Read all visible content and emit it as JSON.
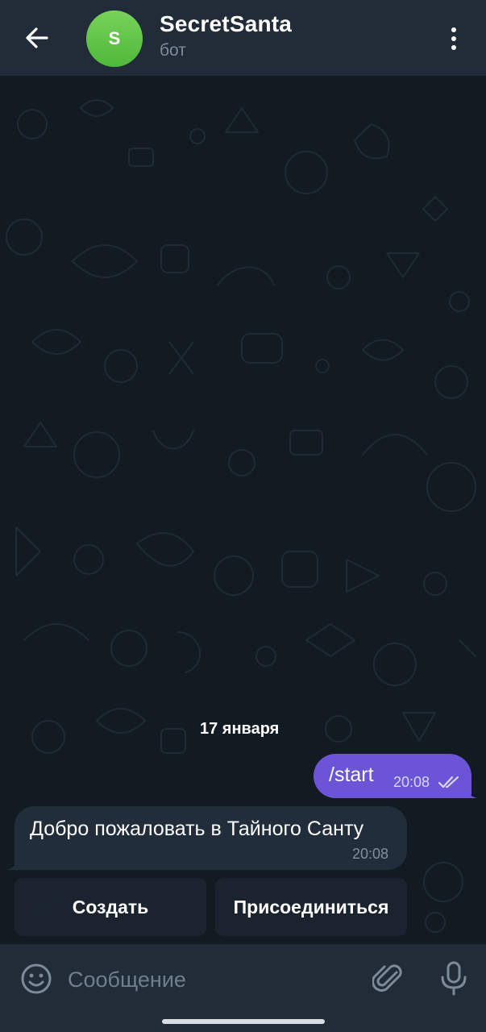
{
  "header": {
    "back_icon": "arrow-left-icon",
    "avatar_letter": "S",
    "avatar_color": "#5cc446",
    "title": "SecretSanta",
    "subtitle": "бот",
    "menu_icon": "more-vertical-icon"
  },
  "chat": {
    "date_label": "17 января",
    "messages": [
      {
        "direction": "outgoing",
        "text": "/start",
        "time": "20:08",
        "status_icon": "double-check-icon",
        "color": "#6b55d6"
      },
      {
        "direction": "incoming",
        "text": "Добро пожаловать в Тайного Санту",
        "time": "20:08",
        "color": "#212d3a"
      }
    ],
    "keyboard_buttons": [
      {
        "label": "Создать"
      },
      {
        "label": "Присоединиться"
      }
    ]
  },
  "composer": {
    "emoji_icon": "smiley-icon",
    "placeholder": "Сообщение",
    "attach_icon": "paperclip-icon",
    "mic_icon": "microphone-icon"
  },
  "colors": {
    "header_bg": "#212c38",
    "chat_bg": "#121a22",
    "accent": "#6b55d6"
  }
}
